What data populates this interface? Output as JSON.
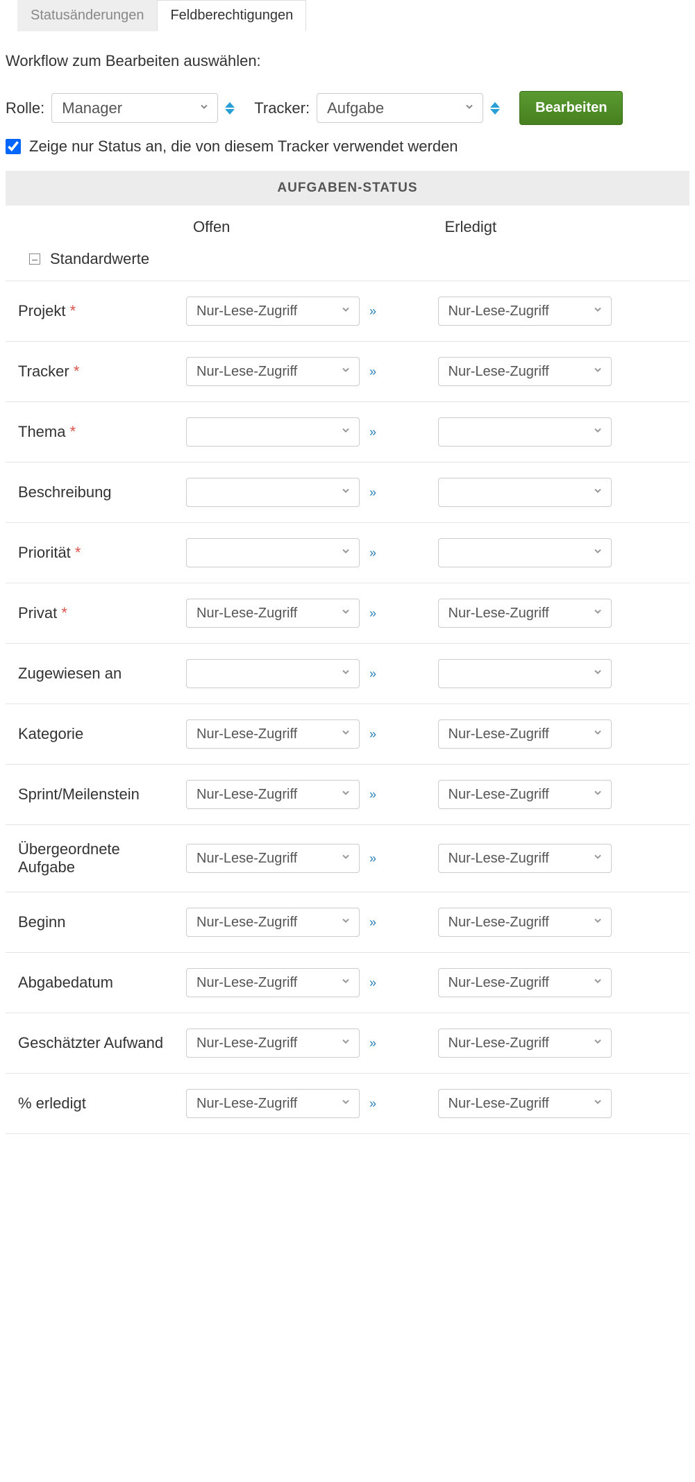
{
  "tabs": {
    "status_changes": "Statusänderungen",
    "field_permissions": "Feldberechtigungen"
  },
  "instruction": "Workflow zum Bearbeiten auswählen:",
  "filters": {
    "role_label": "Rolle:",
    "role_value": "Manager",
    "tracker_label": "Tracker:",
    "tracker_value": "Aufgabe",
    "submit": "Bearbeiten",
    "checkbox_label": "Zeige nur Status an, die von diesem Tracker verwendet werden"
  },
  "table": {
    "status_header": "AUFGABEN-STATUS",
    "columns": {
      "open": "Offen",
      "done": "Erledigt"
    },
    "group_label": "Standardwerte",
    "readonly_value": "Nur-Lese-Zugriff",
    "empty_value": "",
    "fields": [
      {
        "label": "Projekt",
        "required": true,
        "open": "Nur-Lese-Zugriff",
        "done": "Nur-Lese-Zugriff"
      },
      {
        "label": "Tracker",
        "required": true,
        "open": "Nur-Lese-Zugriff",
        "done": "Nur-Lese-Zugriff"
      },
      {
        "label": "Thema",
        "required": true,
        "open": "",
        "done": ""
      },
      {
        "label": "Beschreibung",
        "required": false,
        "open": "",
        "done": ""
      },
      {
        "label": "Priorität",
        "required": true,
        "open": "",
        "done": ""
      },
      {
        "label": "Privat",
        "required": true,
        "open": "Nur-Lese-Zugriff",
        "done": "Nur-Lese-Zugriff"
      },
      {
        "label": "Zugewiesen an",
        "required": false,
        "open": "",
        "done": ""
      },
      {
        "label": "Kategorie",
        "required": false,
        "open": "Nur-Lese-Zugriff",
        "done": "Nur-Lese-Zugriff"
      },
      {
        "label": "Sprint/Meilenstein",
        "required": false,
        "open": "Nur-Lese-Zugriff",
        "done": "Nur-Lese-Zugriff"
      },
      {
        "label": "Übergeordnete Aufgabe",
        "required": false,
        "open": "Nur-Lese-Zugriff",
        "done": "Nur-Lese-Zugriff"
      },
      {
        "label": "Beginn",
        "required": false,
        "open": "Nur-Lese-Zugriff",
        "done": "Nur-Lese-Zugriff"
      },
      {
        "label": "Abgabedatum",
        "required": false,
        "open": "Nur-Lese-Zugriff",
        "done": "Nur-Lese-Zugriff"
      },
      {
        "label": "Geschätzter Aufwand",
        "required": false,
        "open": "Nur-Lese-Zugriff",
        "done": "Nur-Lese-Zugriff"
      },
      {
        "label": "% erledigt",
        "required": false,
        "open": "Nur-Lese-Zugriff",
        "done": "Nur-Lese-Zugriff"
      }
    ]
  }
}
